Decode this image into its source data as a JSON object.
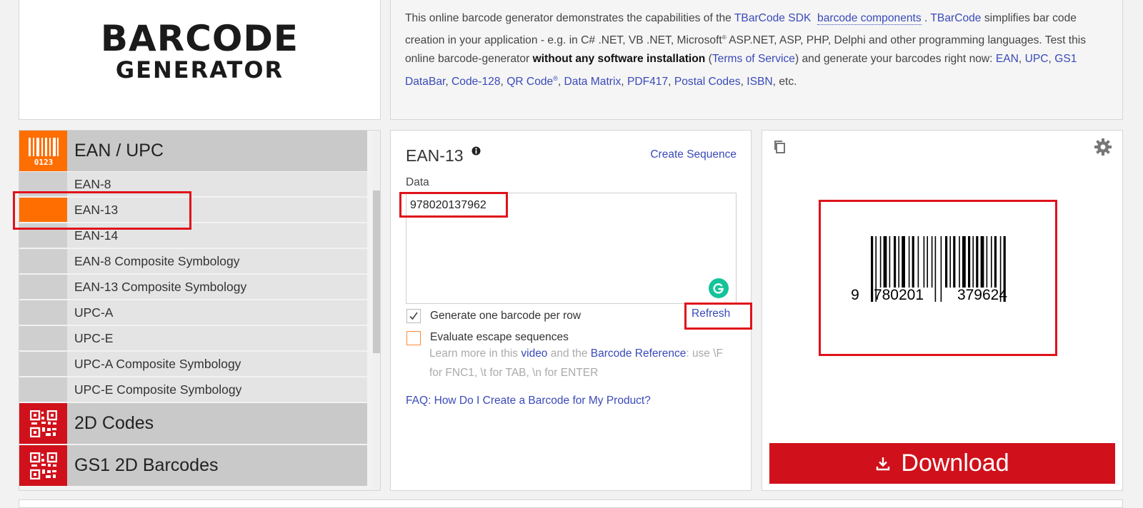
{
  "logo": {
    "line1": "BARCODE",
    "line2": "GENERATOR"
  },
  "intro": {
    "t1": "This online barcode generator demonstrates the capabilities of the ",
    "link_sdk": "TBarCode SDK",
    "link_components": "barcode components",
    "t2": ". ",
    "link_tbarcode": "TBarCode",
    "t3": " simplifies bar code creation in your application - e.g. in C# .NET, VB .NET, Microsoft",
    "sup_reg": "®",
    "t4": " ASP.NET, ASP, PHP, Delphi and other programming languages. Test this online barcode-generator ",
    "bold": "without any software installation",
    "t5": " (",
    "link_tos": "Terms of Service",
    "t6": ") and generate your barcodes right now: ",
    "link_ean": "EAN",
    "sep1": ", ",
    "link_upc": "UPC",
    "sep2": ", ",
    "link_gs1": "GS1 DataBar",
    "sep3": ", ",
    "link_code128": "Code-128",
    "sep4": ", ",
    "link_qr": "QR Code",
    "qr_reg": "®",
    "sep5": ", ",
    "link_dm": "Data Matrix",
    "sep6": ", ",
    "link_pdf": "PDF417",
    "sep7": ", ",
    "link_postal": "Postal Codes",
    "sep8": ", ",
    "link_isbn": "ISBN",
    "t7": ", etc."
  },
  "categories": {
    "ean_upc": "EAN / UPC",
    "items": [
      "EAN-8",
      "EAN-13",
      "EAN-14",
      "EAN-8 Composite Symbology",
      "EAN-13 Composite Symbology",
      "UPC-A",
      "UPC-E",
      "UPC-A Composite Symbology",
      "UPC-E Composite Symbology"
    ],
    "codes_2d": "2D Codes",
    "gs1_2d": "GS1 2D Barcodes",
    "icon_ean_text": "0123"
  },
  "form": {
    "title": "EAN-13",
    "create_sequence": "Create Sequence",
    "data_label": "Data",
    "data_value": "978020137962",
    "cb1_label": "Generate one barcode per row",
    "cb1_checked": true,
    "cb2_label": "Evaluate escape sequences",
    "cb2_checked": false,
    "refresh": "Refresh",
    "help1": "Learn more in this ",
    "help_video": "video",
    "help2": " and the ",
    "help_ref": "Barcode Reference",
    "help3": ": use \\F for FNC1, \\t for TAB, \\n for ENTER",
    "faq": "FAQ: How Do I Create a Barcode for My Product?"
  },
  "preview": {
    "digit_first": "9",
    "digits_left": "780201",
    "digits_right": "379624",
    "download": "Download"
  },
  "icons": {
    "copy": "copy-icon",
    "settings": "gear-icon",
    "info": "info-icon",
    "download": "download-icon",
    "grammarly": "grammarly-icon",
    "check": "check-icon"
  },
  "colors": {
    "accent_orange": "#ff6e00",
    "download_red": "#d0111b",
    "link_blue": "#3a4ab8",
    "category_red": "#d0111b",
    "annotation_red": "#e0121b"
  }
}
